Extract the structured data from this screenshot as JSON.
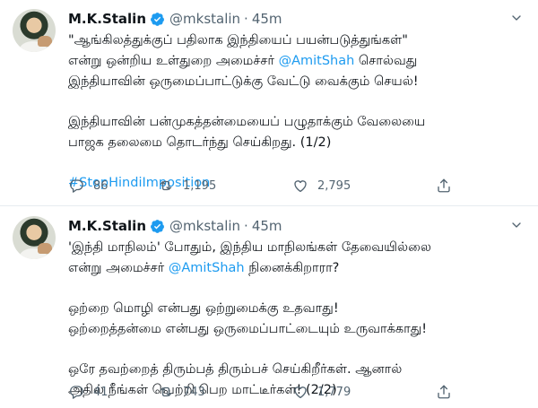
{
  "tweets": [
    {
      "name": "M.K.Stalin",
      "handle": "@mkstalin",
      "separator": "·",
      "time": "45m",
      "lines_a": [
        "\"ஆங்கிலத்துக்குப் பதிலாக இந்தியைப் பயன்படுத்துங்கள்\"",
        "என்று ஒன்றிய உள்துறை அமைச்சர் ",
        "@AmitShah",
        " சொல்வது",
        "இந்தியாவின் ஒருமைப்பாட்டுக்கு வேட்டு வைக்கும் செயல்!"
      ],
      "lines_b": [
        "இந்தியாவின் பன்முகத்தன்மையைப் பழுதாக்கும் வேலையை",
        "பாஜக தலைமை தொடர்ந்து செய்கிறது. (1/2)"
      ],
      "hashtag": "#StopHindiImposition",
      "replies": "86",
      "retweets": "1,195",
      "likes": "2,795"
    },
    {
      "name": "M.K.Stalin",
      "handle": "@mkstalin",
      "separator": "·",
      "time": "45m",
      "line1": "'இந்தி மாநிலம்' போதும், இந்திய மாநிலங்கள் தேவையில்லை",
      "line2_pre": "என்று அமைச்சர் ",
      "line2_link": "@AmitShah",
      "line2_post": " நினைக்கிறாரா?",
      "para2": [
        "ஒற்றை மொழி என்பது ஒற்றுமைக்கு உதவாது!",
        "ஒற்றைத்தன்மை என்பது ஒருமைப்பாட்டையும் உருவாக்காது!"
      ],
      "para3": [
        "ஒரே தவற்றைத் திரும்பத் திரும்பச் செய்கிறீர்கள். ஆனால்",
        "அதில் நீங்கள் வெற்றி பெற மாட்டீர்கள்! (2/2)"
      ],
      "replies": "41",
      "retweets": "743",
      "likes": "1,779"
    }
  ],
  "colors": {
    "link": "#1d9bf0",
    "muted": "#536471",
    "verified": "#1d9bf0"
  },
  "icons": [
    "verified-badge-icon",
    "more-chevron-icon",
    "reply-icon",
    "retweet-icon",
    "like-icon",
    "share-icon"
  ]
}
